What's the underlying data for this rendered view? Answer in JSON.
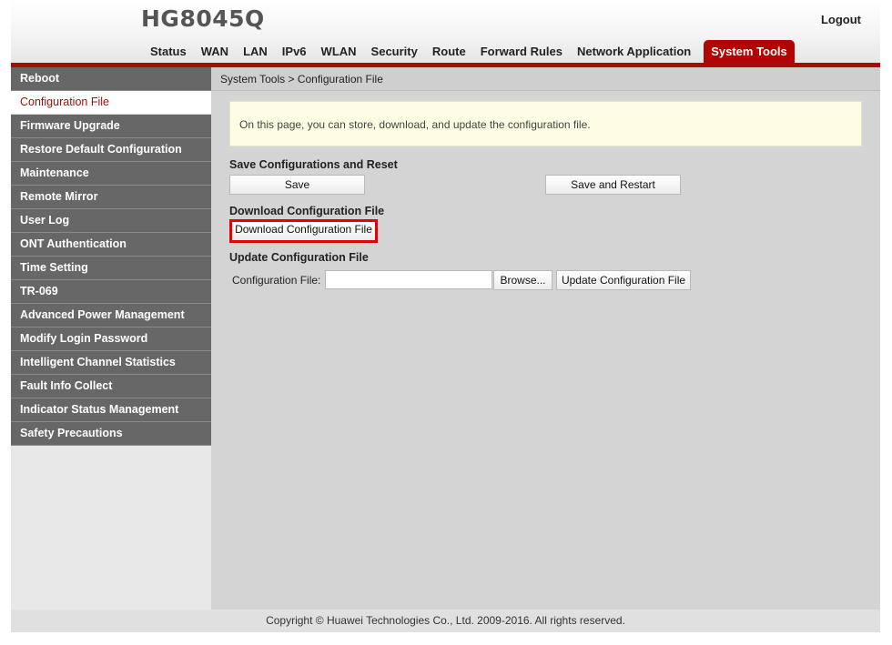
{
  "header": {
    "product": "HG8045Q",
    "logout": "Logout",
    "nav": [
      "Status",
      "WAN",
      "LAN",
      "IPv6",
      "WLAN",
      "Security",
      "Route",
      "Forward Rules",
      "Network Application",
      "System Tools"
    ],
    "active_nav": "System Tools"
  },
  "sidebar": {
    "items": [
      "Reboot",
      "Configuration File",
      "Firmware Upgrade",
      "Restore Default Configuration",
      "Maintenance",
      "Remote Mirror",
      "User Log",
      "ONT Authentication",
      "Time Setting",
      "TR-069",
      "Advanced Power Management",
      "Modify Login Password",
      "Intelligent Channel Statistics",
      "Fault Info Collect",
      "Indicator Status Management",
      "Safety Precautions"
    ],
    "active": "Configuration File"
  },
  "main": {
    "breadcrumb": "System Tools > Configuration File",
    "info": "On this page, you can store, download, and update the configuration file.",
    "save_section": {
      "title": "Save Configurations and Reset",
      "save_button": "Save",
      "save_restart_button": "Save and Restart"
    },
    "download_section": {
      "title": "Download Configuration File",
      "download_button": "Download Configuration File"
    },
    "update_section": {
      "title": "Update Configuration File",
      "field_label": "Configuration File:",
      "field_value": "",
      "browse_button": "Browse...",
      "update_button": "Update Configuration File"
    }
  },
  "footer": {
    "copyright": "Copyright © Huawei Technologies Co., Ltd. 2009-2016. All rights reserved."
  },
  "colors": {
    "brand_red": "#a50d0d",
    "highlight_border": "#e60000",
    "sidebar_bg": "#676767"
  }
}
